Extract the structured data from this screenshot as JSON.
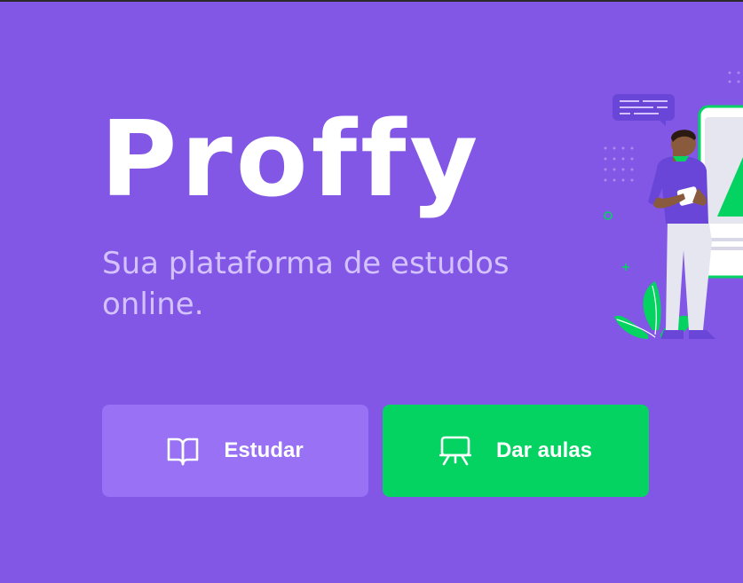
{
  "brand": {
    "name": "Proffy"
  },
  "hero": {
    "tagline": "Sua plataforma de estudos online."
  },
  "actions": {
    "study_label": "Estudar",
    "teach_label": "Dar aulas"
  },
  "icons": {
    "study": "book-open-icon",
    "teach": "presentation-board-icon"
  },
  "colors": {
    "background": "#8257e5",
    "study_button": "#9871f5",
    "teach_button": "#04d361",
    "subtitle": "#d4c2ff",
    "text": "#ffffff"
  }
}
